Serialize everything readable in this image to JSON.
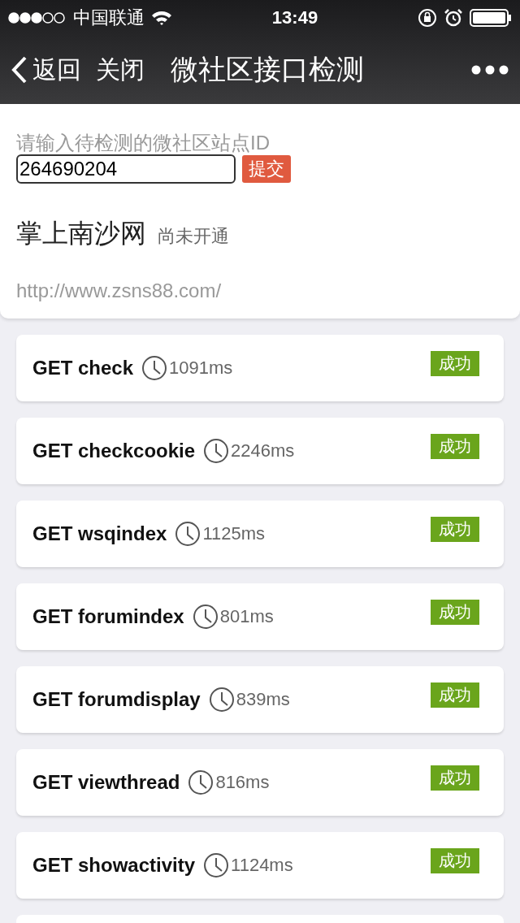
{
  "status_bar": {
    "carrier": "中国联通",
    "time": "13:49"
  },
  "nav": {
    "back": "返回",
    "close": "关闭",
    "title": "微社区接口检测"
  },
  "site_form": {
    "label": "请输入待检测的微社区站点ID",
    "value": "264690204",
    "submit": "提交"
  },
  "site": {
    "name": "掌上南沙网",
    "state": "尚未开通",
    "url": "http://www.zsns88.com/"
  },
  "checks": [
    {
      "method": "GET",
      "name": "check",
      "time": "1091ms",
      "result": "成功"
    },
    {
      "method": "GET",
      "name": "checkcookie",
      "time": "2246ms",
      "result": "成功"
    },
    {
      "method": "GET",
      "name": "wsqindex",
      "time": "1125ms",
      "result": "成功"
    },
    {
      "method": "GET",
      "name": "forumindex",
      "time": "801ms",
      "result": "成功"
    },
    {
      "method": "GET",
      "name": "forumdisplay",
      "time": "839ms",
      "result": "成功"
    },
    {
      "method": "GET",
      "name": "viewthread",
      "time": "816ms",
      "result": "成功"
    },
    {
      "method": "GET",
      "name": "showactivity",
      "time": "1124ms",
      "result": "成功"
    }
  ]
}
